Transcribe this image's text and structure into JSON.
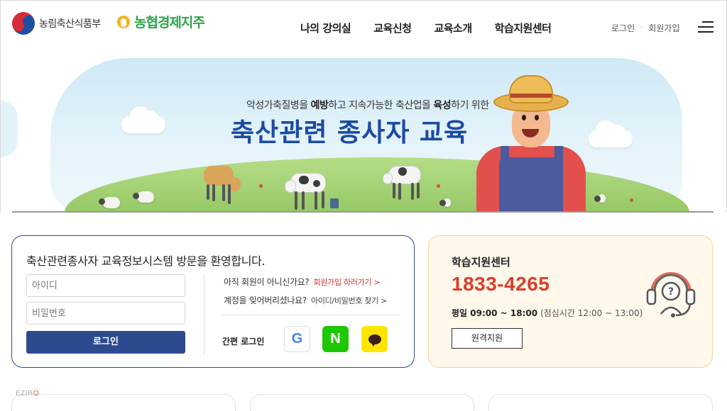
{
  "header": {
    "gov_name": "농림축산식품부",
    "nh_name": "농협경제지주",
    "nav": [
      {
        "label": "나의 강의실"
      },
      {
        "label": "교육신청"
      },
      {
        "label": "교육소개"
      },
      {
        "label": "학습지원센터"
      }
    ],
    "util": {
      "login": "로그인",
      "separator": "·",
      "signup": "회원가입"
    }
  },
  "banner": {
    "subtitle_parts": {
      "p1": "악성가축질병을 ",
      "b1": "예방",
      "p2": "하고 지속가능한 축산업을 ",
      "b2": "육성",
      "p3": "하기 위한"
    },
    "title": "축산관련 종사자 교육"
  },
  "login": {
    "welcome": "축산관련종사자 교육정보시스템 방문을 환영합니다.",
    "id_placeholder": "아이디",
    "pw_placeholder": "비밀번호",
    "login_button": "로그인",
    "not_member": "아직 회원이 아니신가요?",
    "signup_link": "회원가입 하러가기 >",
    "forgot": "계정을 잊어버리셨나요?",
    "find_link": "아이디/비밀번호 찾기 >",
    "easy_login": "간편 로그인",
    "sns": {
      "google": "G",
      "naver": "N",
      "kakao_icon": "kakao-talk-icon"
    }
  },
  "support": {
    "title": "학습지원센터",
    "phone": "1833-4265",
    "hours_label": "평일 09:00 ~ 18:00",
    "lunch": "(점심시간 12:00 ~ 13:00)",
    "remote_button": "원격지원",
    "icon": "headset-support-icon"
  },
  "watermark": {
    "a": "EZIR",
    "b": "O"
  },
  "colors": {
    "primary": "#2e4a8e",
    "accent_red": "#d8402b",
    "support_bg": "#fff8eb",
    "nh_green": "#2aa64a",
    "title_blue": "#1c4aa3"
  }
}
